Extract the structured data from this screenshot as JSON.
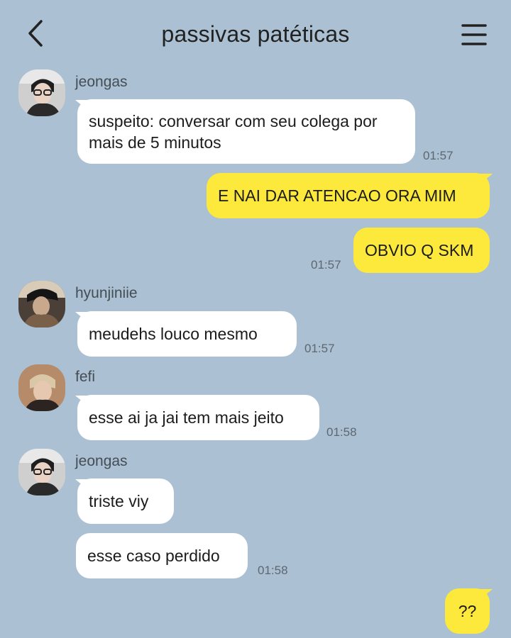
{
  "header": {
    "title": "passivas patéticas",
    "back_icon": "chevron-left-icon",
    "menu_icon": "hamburger-menu-icon"
  },
  "colors": {
    "background": "#abc1d3",
    "incoming_bubble": "#ffffff",
    "outgoing_bubble": "#fde93b"
  },
  "messages": [
    {
      "sender": "jeongas",
      "text": "suspeito: conversar com seu colega por mais de 5 minutos",
      "time": "01:57"
    },
    {
      "outgoing": true,
      "text": "E NAI DAR ATENCAO ORA MIM"
    },
    {
      "outgoing": true,
      "text": "OBVIO Q SKM",
      "time": "01:57"
    },
    {
      "sender": "hyunjiniie",
      "text": "meudehs louco mesmo",
      "time": "01:57"
    },
    {
      "sender": "fefi",
      "text": "esse ai ja jai tem mais jeito",
      "time": "01:58"
    },
    {
      "sender": "jeongas",
      "text": "triste viy"
    },
    {
      "text": "esse caso perdido",
      "time": "01:58"
    },
    {
      "outgoing": true,
      "text": "??"
    }
  ]
}
